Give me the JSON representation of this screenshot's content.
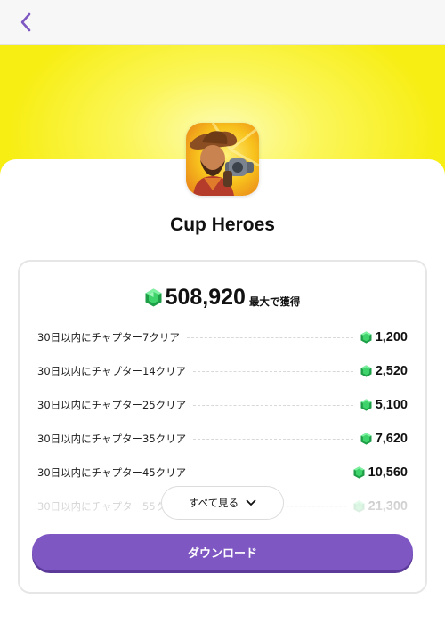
{
  "app": {
    "title": "Cup Heroes"
  },
  "rewards": {
    "total": "508,920",
    "total_suffix": "最大で獲得",
    "items": [
      {
        "label": "30日以内にチャプター7クリア",
        "value": "1,200"
      },
      {
        "label": "30日以内にチャプター14クリア",
        "value": "2,520"
      },
      {
        "label": "30日以内にチャプター25クリア",
        "value": "5,100"
      },
      {
        "label": "30日以内にチャプター35クリア",
        "value": "7,620"
      },
      {
        "label": "30日以内にチャプター45クリア",
        "value": "10,560"
      },
      {
        "label": "30日以内にチャプター55クリア",
        "value": "21,300"
      }
    ]
  },
  "buttons": {
    "see_all": "すべて見る",
    "download": "ダウンロード"
  },
  "icons": {
    "back": "chevron-left-icon",
    "gem": "emerald-gem-icon",
    "see_all_chevron": "chevron-down-icon"
  },
  "colors": {
    "accent": "#7e57c2",
    "hero_yellow": "#f7ee14",
    "gem_green": "#22c55e"
  }
}
